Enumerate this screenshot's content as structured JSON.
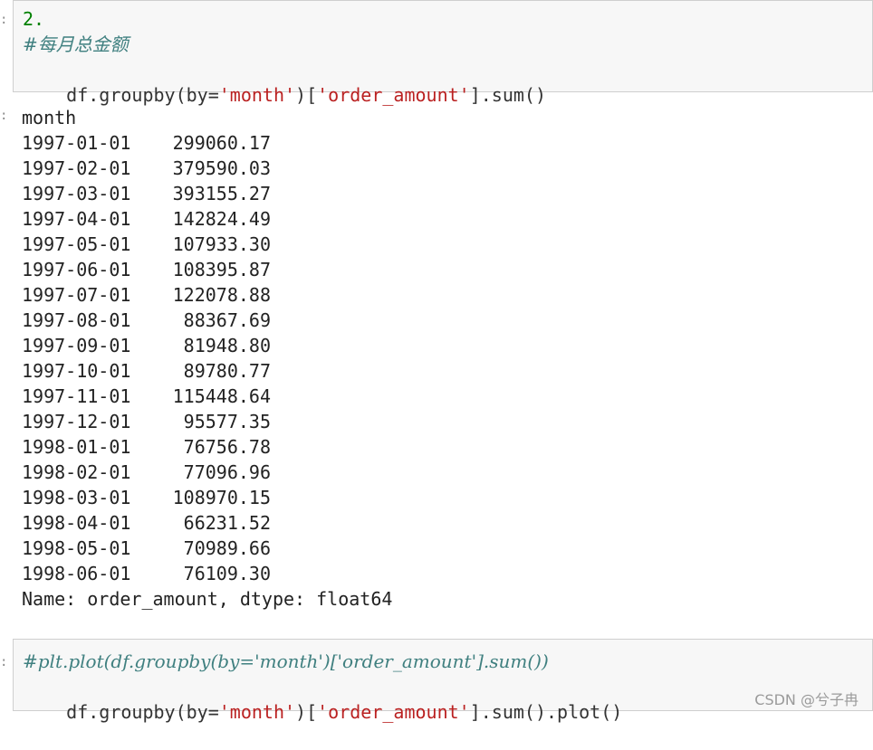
{
  "cell1": {
    "line1": "2.",
    "comment": "#每月总金额",
    "code_prefix": "df.groupby(by=",
    "code_str1": "'month'",
    "code_mid": ")[",
    "code_str2": "'order_amount'",
    "code_suffix": "].sum()"
  },
  "output": {
    "index_name": "month",
    "rows": [
      {
        "date": "1997-01-01",
        "value": "299060.17"
      },
      {
        "date": "1997-02-01",
        "value": "379590.03"
      },
      {
        "date": "1997-03-01",
        "value": "393155.27"
      },
      {
        "date": "1997-04-01",
        "value": "142824.49"
      },
      {
        "date": "1997-05-01",
        "value": "107933.30"
      },
      {
        "date": "1997-06-01",
        "value": "108395.87"
      },
      {
        "date": "1997-07-01",
        "value": "122078.88"
      },
      {
        "date": "1997-08-01",
        "value": "88367.69"
      },
      {
        "date": "1997-09-01",
        "value": "81948.80"
      },
      {
        "date": "1997-10-01",
        "value": "89780.77"
      },
      {
        "date": "1997-11-01",
        "value": "115448.64"
      },
      {
        "date": "1997-12-01",
        "value": "95577.35"
      },
      {
        "date": "1998-01-01",
        "value": "76756.78"
      },
      {
        "date": "1998-02-01",
        "value": "77096.96"
      },
      {
        "date": "1998-03-01",
        "value": "108970.15"
      },
      {
        "date": "1998-04-01",
        "value": "66231.52"
      },
      {
        "date": "1998-05-01",
        "value": "70989.66"
      },
      {
        "date": "1998-06-01",
        "value": "76109.30"
      }
    ],
    "footer": "Name: order_amount, dtype: float64"
  },
  "cell2": {
    "comment": "#plt.plot(df.groupby(by='month')['order_amount'].sum())",
    "code_prefix": "df.groupby(by=",
    "code_str1": "'month'",
    "code_mid": ")[",
    "code_str2": "'order_amount'",
    "code_suffix": "].sum().plot()"
  },
  "watermark": "CSDN @兮子冉"
}
